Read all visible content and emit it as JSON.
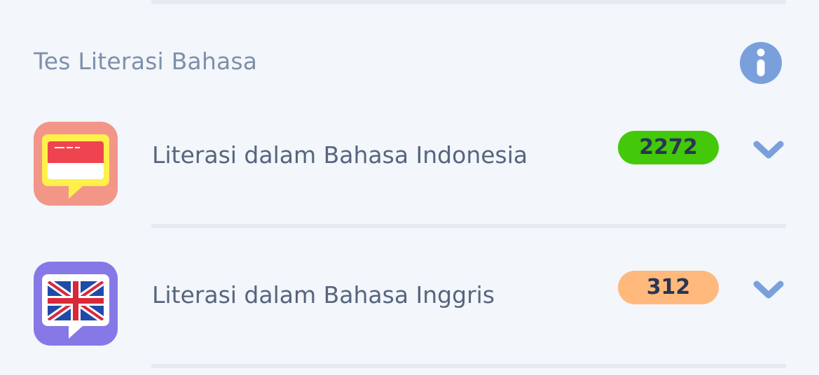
{
  "section": {
    "title": "Tes Literasi Bahasa",
    "info_icon": "info-icon"
  },
  "colors": {
    "background": "#f3f6fa",
    "divider": "#e6eaf1",
    "section_title": "#7e90ab",
    "label": "#56657f",
    "info": "#7aa0dc",
    "chevron": "#7aa0dc"
  },
  "tests": [
    {
      "label": "Literasi dalam Bahasa Indonesia",
      "count": "2272",
      "badge_color": "#44c80a",
      "icon": "indonesia-flag-speech-icon",
      "icon_bg": "#f29688"
    },
    {
      "label": "Literasi dalam Bahasa Inggris",
      "count": "312",
      "badge_color": "#ffb97c",
      "icon": "uk-flag-speech-icon",
      "icon_bg": "#8678e6"
    }
  ]
}
